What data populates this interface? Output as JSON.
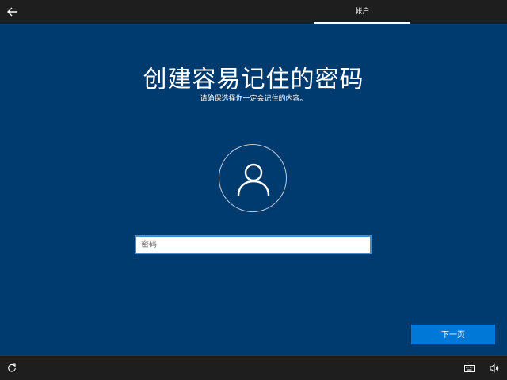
{
  "header": {
    "back_icon": "back-arrow-icon",
    "tab_label": "帐户"
  },
  "main": {
    "title": "创建容易记住的密码",
    "subtitle": "请确保选择你一定会记住的内容。",
    "avatar_icon": "user-icon",
    "password_placeholder": "密码",
    "next_label": "下一页"
  },
  "footer": {
    "icons": [
      "accessibility-icon",
      "keyboard-icon",
      "volume-icon"
    ]
  },
  "colors": {
    "background": "#003b6f",
    "bar": "#1e1e1e",
    "accent": "#0078d7",
    "input_border": "#3d8fd6"
  }
}
